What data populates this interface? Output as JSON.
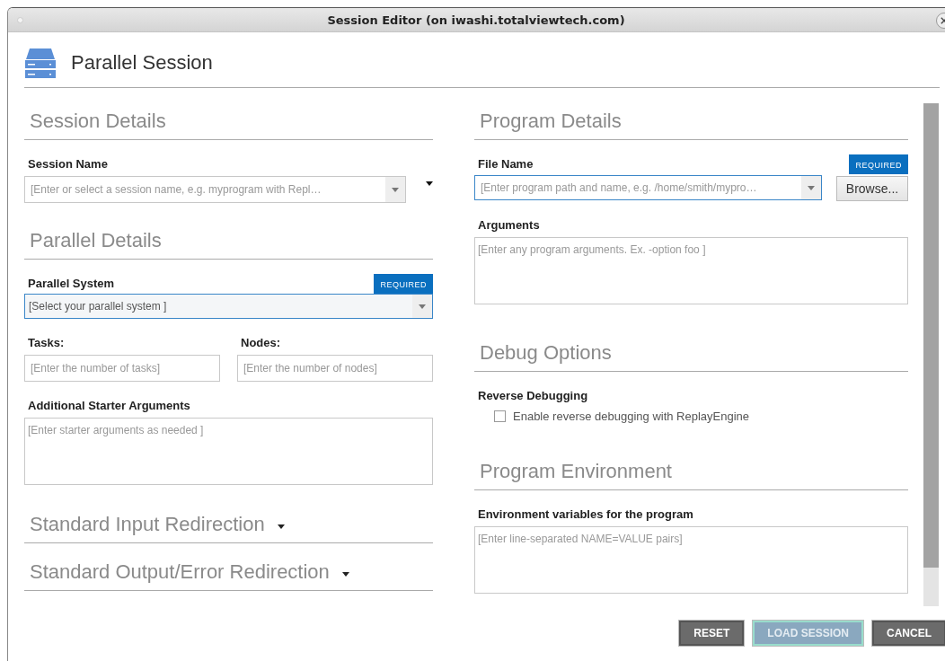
{
  "window": {
    "title": "Session Editor (on iwashi.totalviewtech.com)"
  },
  "header": {
    "title": "Parallel Session"
  },
  "columns": [
    [
      {
        "heading": "Session Details",
        "fields": [
          {
            "kind": "combo",
            "label": "Session Name",
            "placeholder": "[Enter or select a session name,  e.g. myprogram with Repl…"
          }
        ]
      },
      {
        "heading": "Parallel Details",
        "fields": [
          {
            "kind": "select",
            "label": "Parallel System",
            "badge": "REQUIRED",
            "value": "[Select your parallel system ]"
          },
          {
            "kind": "pair",
            "items": [
              {
                "label": "Tasks:",
                "placeholder": "[Enter the number of tasks]"
              },
              {
                "label": "Nodes:",
                "placeholder": "[Enter the number of nodes]"
              }
            ]
          },
          {
            "kind": "textarea",
            "label": "Additional Starter Arguments",
            "placeholder": "[Enter starter arguments as needed ]"
          }
        ]
      },
      {
        "heading": "Standard Input Redirection",
        "expanded": false
      },
      {
        "heading": "Standard Output/Error Redirection",
        "expanded": false
      }
    ],
    [
      {
        "heading": "Program Details",
        "fields": [
          {
            "kind": "file",
            "label": "File Name",
            "badge": "REQUIRED",
            "placeholder": "[Enter program path and name, e.g. /home/smith/mypro…",
            "button": "Browse..."
          },
          {
            "kind": "textarea",
            "label": "Arguments",
            "placeholder": "[Enter any program arguments. Ex. -option foo ]"
          }
        ]
      },
      {
        "heading": "Debug Options",
        "fields": [
          {
            "kind": "checkbox",
            "label": "Reverse Debugging",
            "option": "Enable reverse debugging with ReplayEngine",
            "checked": false
          }
        ]
      },
      {
        "heading": "Program Environment",
        "fields": [
          {
            "kind": "textarea",
            "label": "Environment variables for the program",
            "placeholder": "[Enter line-separated NAME=VALUE pairs]"
          }
        ]
      }
    ]
  ],
  "buttons": [
    {
      "label": "RESET",
      "disabled": false
    },
    {
      "label": "LOAD SESSION",
      "disabled": true
    },
    {
      "label": "CANCEL",
      "disabled": false
    }
  ]
}
